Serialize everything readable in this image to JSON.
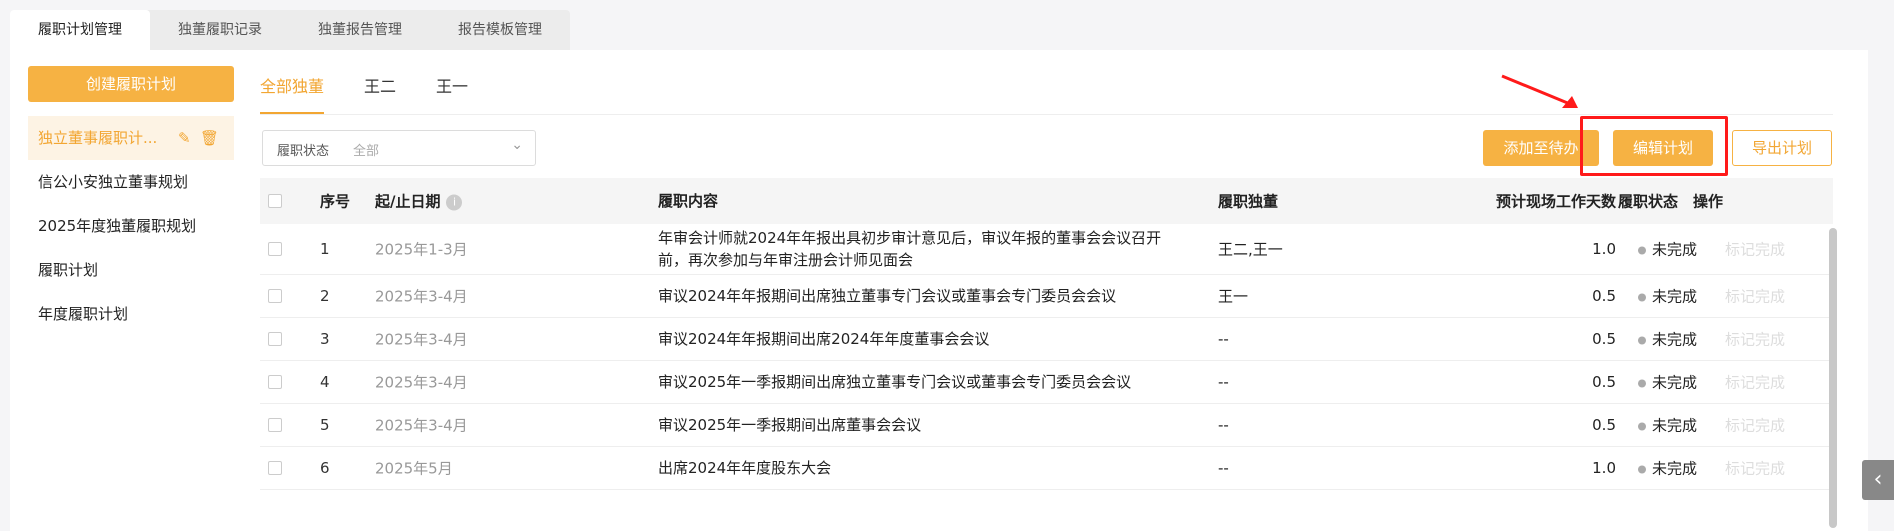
{
  "top_tabs": [
    "履职计划管理",
    "独董履职记录",
    "独董报告管理",
    "报告模板管理"
  ],
  "sidebar": {
    "create_label": "创建履职计划",
    "items": [
      "独立董事履职计...",
      "信公小安独立董事规划",
      "2025年度独董履职规划",
      "履职计划",
      "年度履职计划"
    ]
  },
  "sub_tabs": [
    "全部独董",
    "王二",
    "王一"
  ],
  "filter": {
    "label": "履职状态",
    "value": "全部"
  },
  "buttons": {
    "add": "添加至待办",
    "edit": "编辑计划",
    "export": "导出计划"
  },
  "table": {
    "headers": {
      "idx": "序号",
      "date": "起/止日期",
      "content": "履职内容",
      "director": "履职独董",
      "days": "预计现场工作天数",
      "status": "履职状态",
      "op": "操作"
    },
    "rows": [
      {
        "idx": "1",
        "date": "2025年1-3月",
        "content": "年审会计师就2024年年报出具初步审计意见后，审议年报的董事会会议召开前，再次参加与年审注册会计师见面会",
        "director": "王二,王一",
        "days": "1.0",
        "status": "未完成",
        "op": "标记完成"
      },
      {
        "idx": "2",
        "date": "2025年3-4月",
        "content": "审议2024年年报期间出席独立董事专门会议或董事会专门委员会会议",
        "director": "王一",
        "days": "0.5",
        "status": "未完成",
        "op": "标记完成"
      },
      {
        "idx": "3",
        "date": "2025年3-4月",
        "content": "审议2024年年报期间出席2024年年度董事会会议",
        "director": "--",
        "days": "0.5",
        "status": "未完成",
        "op": "标记完成"
      },
      {
        "idx": "4",
        "date": "2025年3-4月",
        "content": "审议2025年一季报期间出席独立董事专门会议或董事会专门委员会会议",
        "director": "--",
        "days": "0.5",
        "status": "未完成",
        "op": "标记完成"
      },
      {
        "idx": "5",
        "date": "2025年3-4月",
        "content": "审议2025年一季报期间出席董事会会议",
        "director": "--",
        "days": "0.5",
        "status": "未完成",
        "op": "标记完成"
      },
      {
        "idx": "6",
        "date": "2025年5月",
        "content": "出席2024年年度股东大会",
        "director": "--",
        "days": "1.0",
        "status": "未完成",
        "op": "标记完成"
      }
    ]
  },
  "icons": {
    "edit": "edit-icon",
    "delete": "trash-icon",
    "info": "info-icon",
    "chevron": "chevron-down-icon",
    "collapse": "chevron-left-icon"
  },
  "colors": {
    "accent": "#f6b243",
    "accent_text": "#f2a632",
    "annotation": "#ff1a1a"
  }
}
